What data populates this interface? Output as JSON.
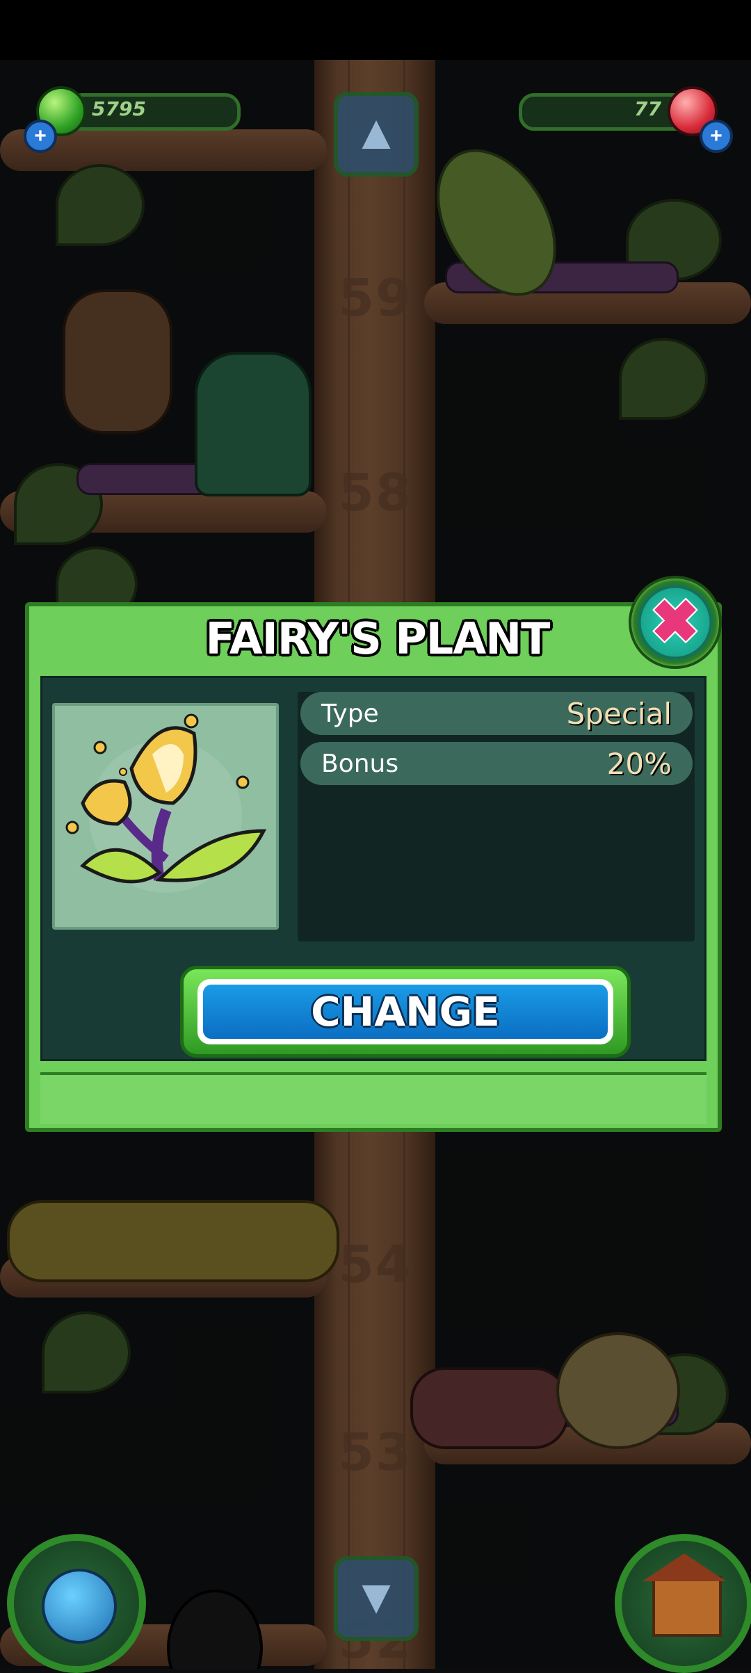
{
  "hud": {
    "coins_value": "5795",
    "gems_value": "77"
  },
  "floors": [
    "59",
    "58",
    "54",
    "53",
    "52"
  ],
  "dialog": {
    "title": "FAIRY'S PLANT",
    "stats": [
      {
        "label": "Type",
        "value": "Special"
      },
      {
        "label": "Bonus",
        "value": "20%"
      }
    ],
    "change_label": "CHANGE"
  },
  "icons": {
    "coins": "green-gem-icon",
    "gems": "red-crystal-icon",
    "close": "close-x-icon",
    "up": "arrow-up-icon",
    "down": "arrow-down-icon",
    "world": "globe-icon",
    "home": "house-icon"
  },
  "colors": {
    "dialog_green": "#6fcf5b",
    "panel_dark": "#193b36",
    "button_blue": "#1a9be6",
    "close_pink": "#e8377a"
  }
}
